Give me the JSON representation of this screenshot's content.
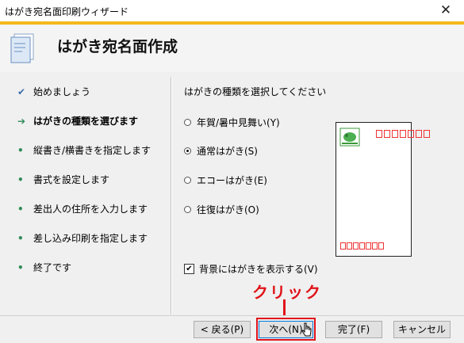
{
  "window": {
    "title": "はがき宛名面印刷ウィザード",
    "close_glyph": "✕"
  },
  "header": {
    "title": "はがき宛名面作成"
  },
  "steps": [
    {
      "label": "始めましょう",
      "state": "done",
      "bullet": "✔"
    },
    {
      "label": "はがきの種類を選びます",
      "state": "current",
      "bullet": "➔"
    },
    {
      "label": "縦書き/横書きを指定します",
      "state": "todo",
      "bullet": "•"
    },
    {
      "label": "書式を設定します",
      "state": "todo",
      "bullet": "•"
    },
    {
      "label": "差出人の住所を入力します",
      "state": "todo",
      "bullet": "•"
    },
    {
      "label": "差し込み印刷を指定します",
      "state": "todo",
      "bullet": "•"
    },
    {
      "label": "終了です",
      "state": "todo",
      "bullet": "•"
    }
  ],
  "main": {
    "prompt": "はがきの種類を選択してください",
    "options": [
      {
        "label": "年賀/暑中見舞い(Y)",
        "selected": false
      },
      {
        "label": "通常はがき(S)",
        "selected": true
      },
      {
        "label": "エコーはがき(E)",
        "selected": false
      },
      {
        "label": "往復はがき(O)",
        "selected": false
      }
    ],
    "show_background": {
      "label": "背景にはがきを表示する(V)",
      "checked": true,
      "glyph": "✔"
    }
  },
  "buttons": {
    "back": "< 戻る(P)",
    "next": "次へ(N)",
    "finish": "完了(F)",
    "cancel": "キャンセル"
  },
  "annotation": {
    "text": "クリック",
    "color": "#e0141a"
  },
  "colors": {
    "accent": "#f4b81b",
    "highlight": "#e0141a",
    "postal_box": "#e33333"
  }
}
